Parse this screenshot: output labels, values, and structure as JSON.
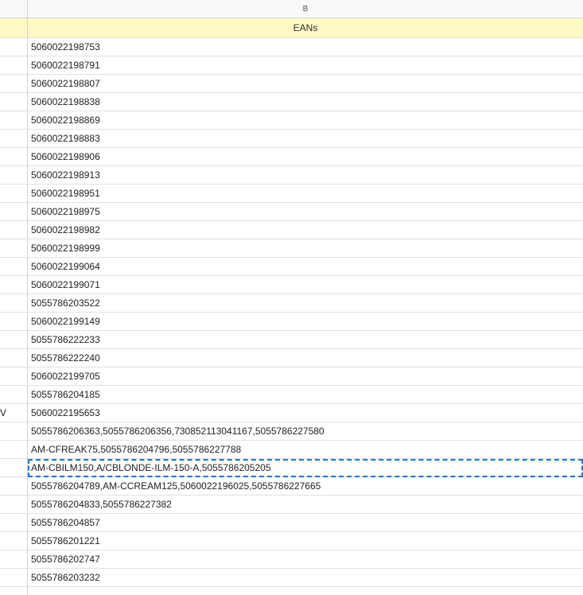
{
  "columns": {
    "a_header": "",
    "b_header": "B"
  },
  "header_row": {
    "a": "",
    "b": "EANs"
  },
  "col_a_cells": [
    "",
    "",
    "",
    "",
    "",
    "",
    "",
    "",
    "",
    "",
    "",
    "",
    "",
    "",
    "",
    "",
    "",
    "",
    "",
    "",
    "V",
    "",
    "",
    "",
    "",
    "",
    "",
    "",
    "",
    ""
  ],
  "rows": [
    "5060022198753",
    "5060022198791",
    "5060022198807",
    "5060022198838",
    "5060022198869",
    "5060022198883",
    "5060022198906",
    "5060022198913",
    "5060022198951",
    "5060022198975",
    "5060022198982",
    "5060022198999",
    "5060022199064",
    "5060022199071",
    "5055786203522",
    "5060022199149",
    "5055786222233",
    "5055786222240",
    "5060022199705",
    "5055786204185",
    "5060022195653",
    "5055786206363,5055786206356,730852113041167,5055786227580",
    "AM-CFREAK75,5055786204796,5055786227788",
    "AM-CBILM150,A/CBLONDE-ILM-150-A,5055786205205",
    "5055786204789,AM-CCREAM125,5060022196025,5055786227665",
    "5055786204833,5055786227382",
    "5055786204857",
    "5055786201221",
    "5055786202747",
    "5055786203232"
  ],
  "selected_row_index": 23,
  "colors": {
    "selection": "#1a73e8",
    "header_fill": "#fff9c4"
  }
}
